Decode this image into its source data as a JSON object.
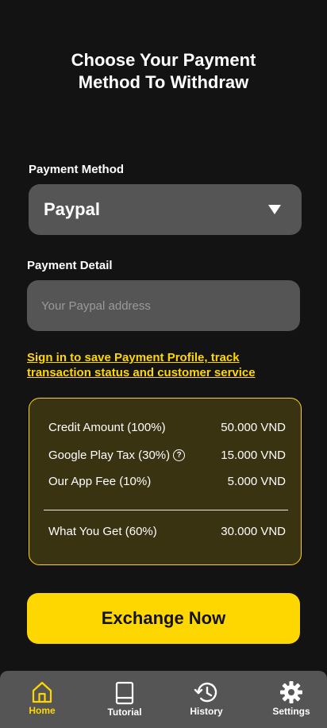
{
  "page": {
    "title_line1": "Choose Your Payment",
    "title_line2": "Method To Withdraw"
  },
  "payment_method": {
    "label": "Payment Method",
    "selected": "Paypal"
  },
  "payment_detail": {
    "label": "Payment Detail",
    "placeholder": "Your Paypal address",
    "value": ""
  },
  "signin_link": "Sign in to save Payment Profile, track transaction status and customer service",
  "summary": {
    "rows": [
      {
        "label": "Credit Amount (100%)",
        "value": "50.000 VND"
      },
      {
        "label": "Google Play Tax (30%)",
        "value": "15.000 VND"
      },
      {
        "label": "Our App Fee (10%)",
        "value": "5.000 VND"
      }
    ],
    "total": {
      "label": "What You Get (60%)",
      "value": "30.000 VND"
    }
  },
  "cta_label": "Exchange Now",
  "nav": {
    "items": [
      {
        "label": "Home",
        "icon": "home-icon",
        "active": true
      },
      {
        "label": "Tutorial",
        "icon": "book-icon",
        "active": false
      },
      {
        "label": "History",
        "icon": "history-icon",
        "active": false
      },
      {
        "label": "Settings",
        "icon": "gear-icon",
        "active": false
      }
    ]
  },
  "colors": {
    "background": "#131313",
    "field": "#555555",
    "accent": "#ffd700",
    "summary_bg": "#3a3312"
  }
}
